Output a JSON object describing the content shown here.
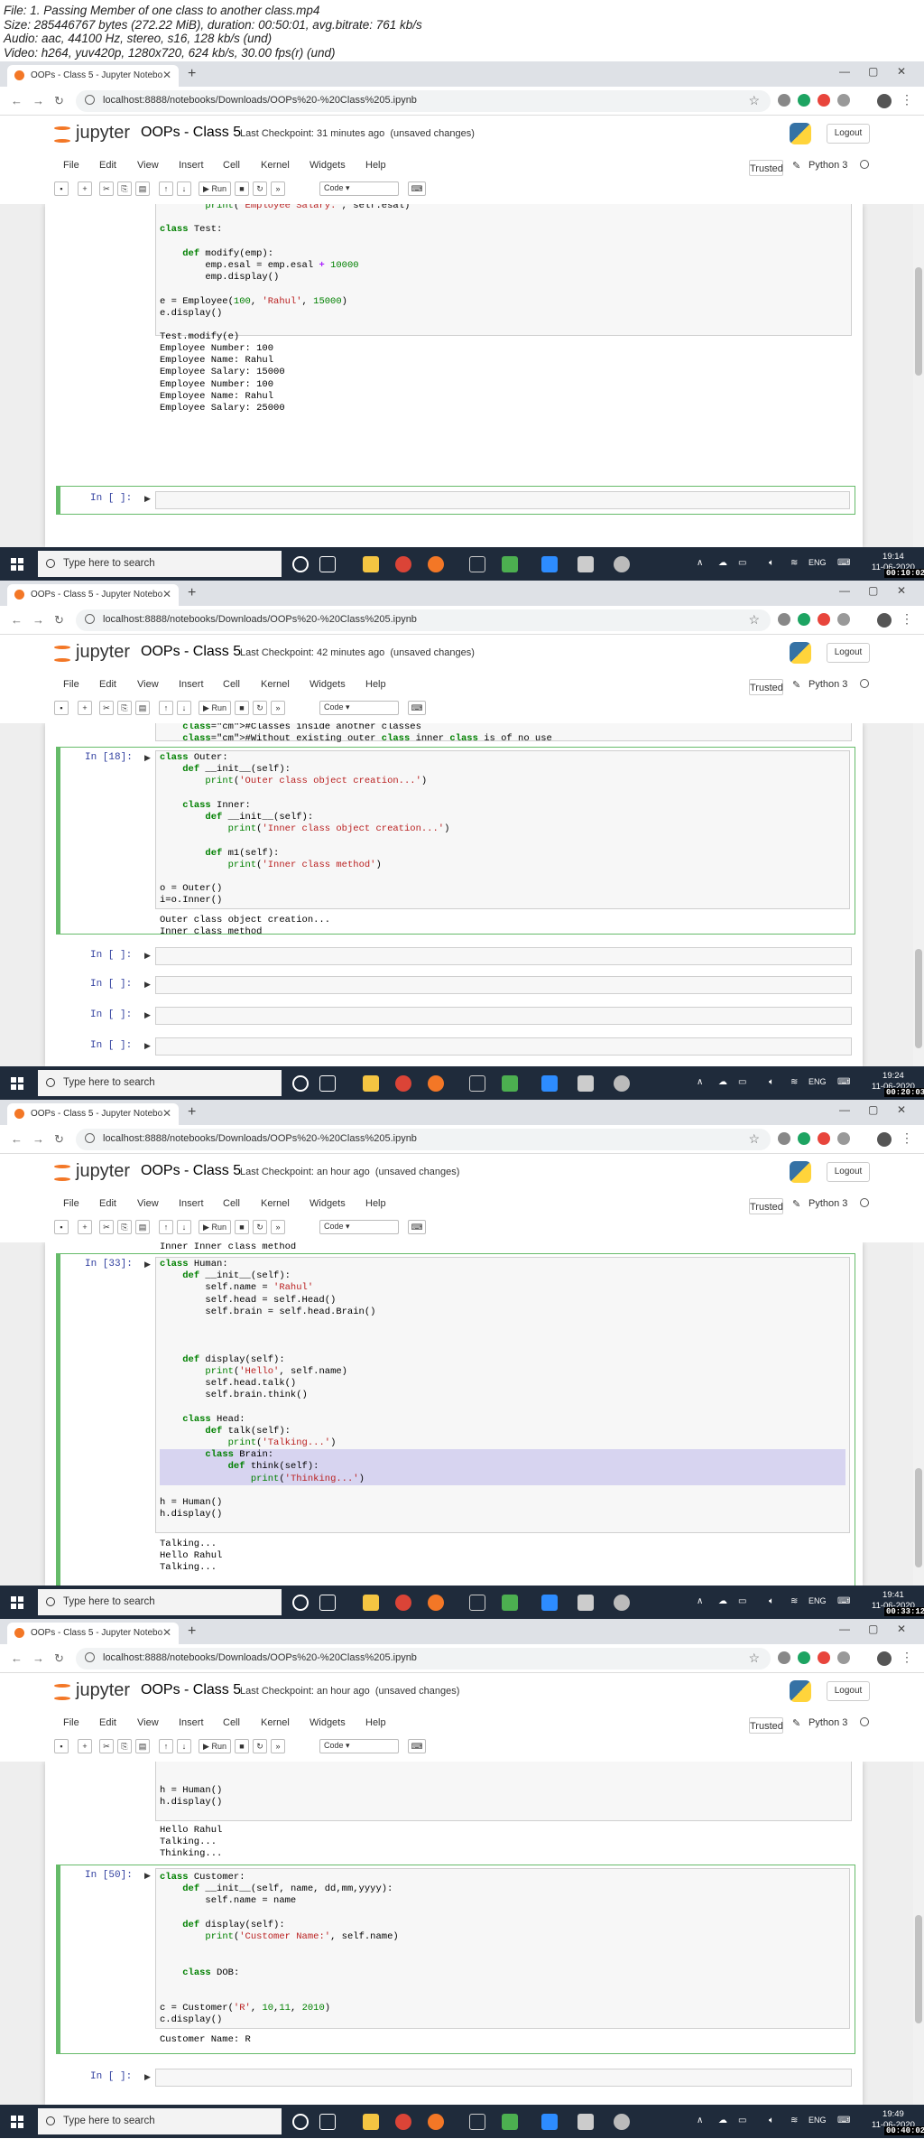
{
  "file_info": [
    "File: 1. Passing Member of one class to another class.mp4",
    "Size: 285446767 bytes (272.22 MiB), duration: 00:50:01, avg.bitrate: 761 kb/s",
    "Audio: aac, 44100 Hz, stereo, s16, 128 kb/s (und)",
    "Video: h264, yuv420p, 1280x720, 624 kb/s, 30.00 fps(r) (und)"
  ],
  "common": {
    "tab_title": "OOPs - Class 5 - Jupyter Notebo",
    "new_tab": "+",
    "url": "localhost:8888/notebooks/Downloads/OOPs%20-%20Class%205.ipynb",
    "jupyter_label": "jupyter",
    "notebook_title": "OOPs - Class 5",
    "logout": "Logout",
    "menus": [
      "File",
      "Edit",
      "View",
      "Insert",
      "Cell",
      "Kernel",
      "Widgets",
      "Help"
    ],
    "trusted": "Trusted",
    "kernel": "Python 3",
    "run_label": "Run",
    "cell_type": "Code",
    "search_placeholder": "Type here to search",
    "lang": "ENG",
    "date": "11-06-2020",
    "empty_prompt": "In [ ]:"
  },
  "colors": {
    "accent_green": "#66bb6a",
    "jupyter_orange": "#f37726",
    "taskbar": "#1f2b3b",
    "prompt_blue": "#303f9f"
  },
  "frames": [
    {
      "checkpoint": "Last Checkpoint: 31 minutes ago",
      "unsaved": "(unsaved changes)",
      "clock": "19:14",
      "timestamp": "00:10:02",
      "code_top": "        print('Employee Salary:', self.esal)\n\nclass Test:\n\n    def modify(emp):\n        emp.esal = emp.esal + 10000\n        emp.display()\n\ne = Employee(100, 'Rahul', 15000)\ne.display()\n\nTest.modify(e)",
      "output_top": "Employee Number: 100\nEmployee Name: Rahul\nEmployee Salary: 15000\nEmployee Number: 100\nEmployee Name: Rahul\nEmployee Salary: 25000"
    },
    {
      "checkpoint": "Last Checkpoint: 42 minutes ago",
      "unsaved": "(unsaved changes)",
      "clock": "19:24",
      "timestamp": "00:20:03",
      "code_top": "    #Classes inside another classes\n    #Without existing outer class inner class is of no use",
      "prompt": "In [18]:",
      "code": "class Outer:\n    def __init__(self):\n        print('Outer class object creation...')\n\n    class Inner:\n        def __init__(self):\n            print('Inner class object creation...')\n\n        def m1(self):\n            print('Inner class method')\n\no = Outer()\ni=o.Inner()",
      "output": "Outer class object creation...\nInner class method"
    },
    {
      "checkpoint": "Last Checkpoint: an hour ago",
      "unsaved": "(unsaved changes)",
      "clock": "19:41",
      "timestamp": "00:33:12",
      "output_top": "Inner Inner class object creation...\nInner Inner class method",
      "prompt": "In [33]:",
      "code": "class Human:\n    def __init__(self):\n        self.name = 'Rahul'\n        self.head = self.Head()\n        self.brain = self.head.Brain()\n\n\n\n    def display(self):\n        print('Hello', self.name)\n        self.head.talk()\n        self.brain.think()\n\n    class Head:\n        def talk(self):\n            print('Talking...')\n",
      "code_hl": "        class Brain:\n            def think(self):\n                print('Thinking...')",
      "code_after": "\nh = Human()\nh.display()",
      "output": "Talking...\nHello Rahul\nTalking..."
    },
    {
      "checkpoint": "Last Checkpoint: an hour ago",
      "unsaved": "(unsaved changes)",
      "clock": "19:49",
      "timestamp": "00:40:02",
      "code_top": "                print('Thinking...')\n\n\nh = Human()\nh.display()",
      "output_top": "Hello Rahul\nTalking...\nThinking...",
      "prompt": "In [50]:",
      "code": "class Customer:\n    def __init__(self, name, dd,mm,yyyy):\n        self.name = name\n\n    def display(self):\n        print('Customer Name:', self.name)\n\n\n    class DOB:\n\n\nc = Customer('R', 10,11, 2010)\nc.display()",
      "output": "Customer Name: R"
    }
  ]
}
